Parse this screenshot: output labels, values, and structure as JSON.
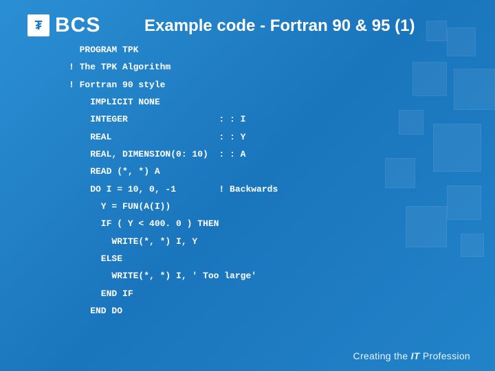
{
  "logo": {
    "icon": "₮",
    "text": "BCS"
  },
  "title": "Example code - Fortran 90 & 95 (1)",
  "code_lines": [
    {
      "indent": 1,
      "text": "PROGRAM TPK"
    },
    {
      "indent": 0,
      "text": "! The TPK Algorithm"
    },
    {
      "indent": 0,
      "text": "! Fortran 90 style"
    },
    {
      "indent": 2,
      "text": "IMPLICIT NONE"
    },
    {
      "indent": 2,
      "text": "INTEGER                 : : I"
    },
    {
      "indent": 2,
      "text": "REAL                    : : Y"
    },
    {
      "indent": 2,
      "text": "REAL, DIMENSION(0: 10)  : : A"
    },
    {
      "indent": 2,
      "text": "READ (*, *) A"
    },
    {
      "indent": 2,
      "text": "DO I = 10, 0, -1        ! Backwards"
    },
    {
      "indent": 3,
      "text": "Y = FUN(A(I))"
    },
    {
      "indent": 3,
      "text": "IF ( Y < 400. 0 ) THEN"
    },
    {
      "indent": 4,
      "text": "WRITE(*, *) I, Y"
    },
    {
      "indent": 3,
      "text": "ELSE"
    },
    {
      "indent": 4,
      "text": "WRITE(*, *) I, ' Too large'"
    },
    {
      "indent": 3,
      "text": "END IF"
    },
    {
      "indent": 2,
      "text": "END DO"
    }
  ],
  "footer": {
    "pre": "Creating the ",
    "emph": "IT",
    "post": " Profession"
  }
}
